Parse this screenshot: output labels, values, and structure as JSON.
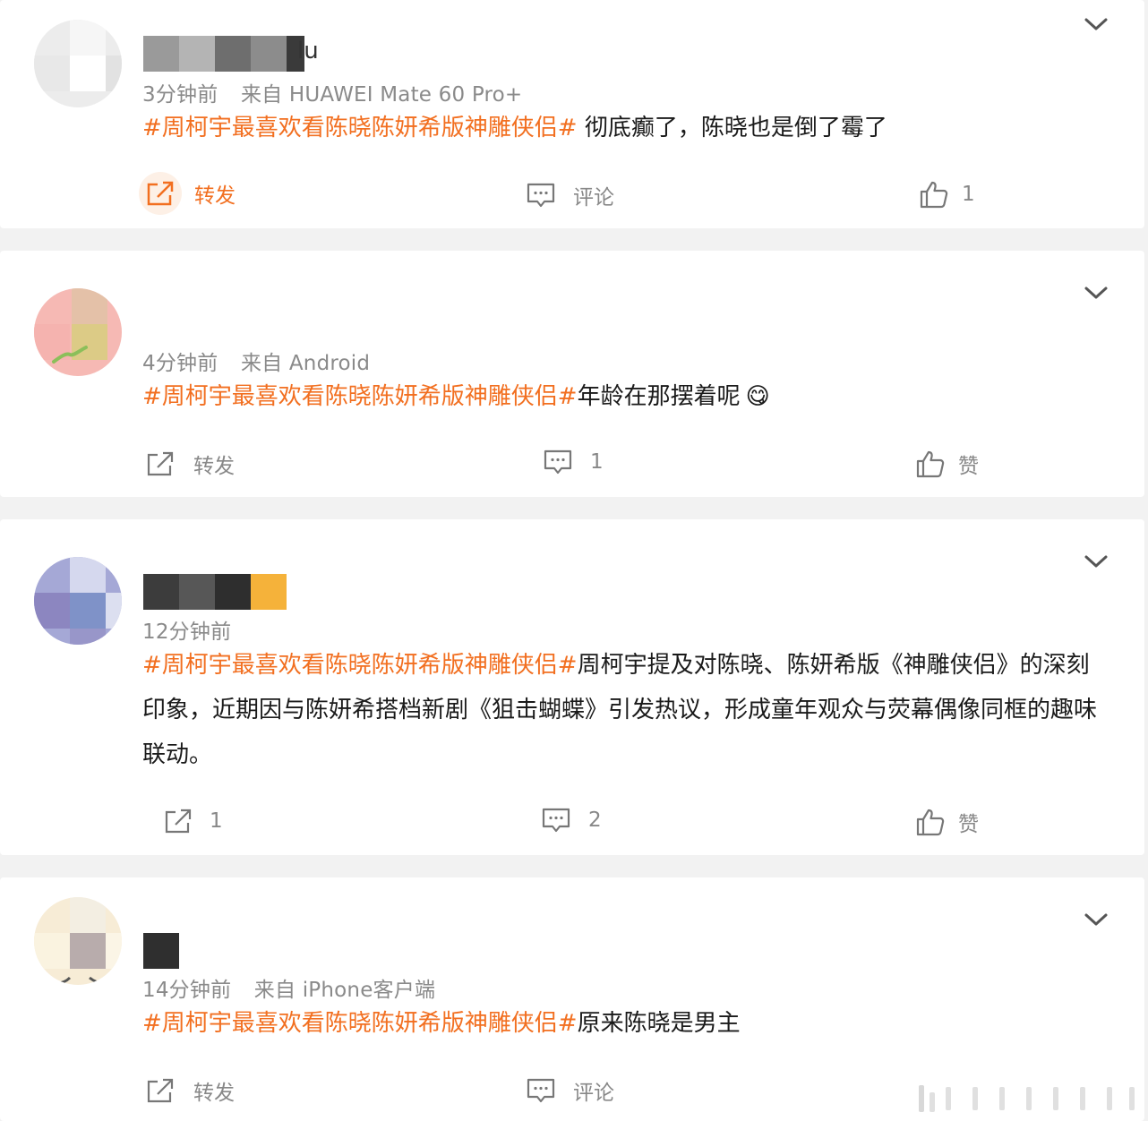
{
  "colors": {
    "topic": "#f26f20",
    "meta": "#8a8a8a",
    "text": "#1a1a1a",
    "background": "#f2f2f2",
    "card": "#ffffff"
  },
  "comments": [
    {
      "name_visible_suffix": "lu",
      "time": "3分钟前",
      "source": "来自 HUAWEI Mate 60 Pro+",
      "topic": "#周柯宇最喜欢看陈晓陈妍希版神雕侠侣#",
      "text": " 彻底癫了，陈晓也是倒了霉了",
      "repost_label": "转发",
      "comment_label": "评论",
      "like_label": "1",
      "repost_icon": "repost-icon",
      "comment_icon": "comment-icon",
      "like_icon": "thumb-up-icon"
    },
    {
      "name_visible_suffix": "",
      "time": "4分钟前",
      "source": "来自 Android",
      "topic": "#周柯宇最喜欢看陈晓陈妍希版神雕侠侣#",
      "text": "年龄在那摆着呢",
      "emoji": "😋",
      "repost_label": "转发",
      "comment_label": "1",
      "like_label": "赞"
    },
    {
      "name_visible_suffix": "",
      "time": "12分钟前",
      "source": "",
      "topic": "#周柯宇最喜欢看陈晓陈妍希版神雕侠侣#",
      "text": "周柯宇提及对陈晓、陈妍希版《神雕侠侣》的深刻印象，近期因与陈妍希搭档新剧《狙击蝴蝶》引发热议，形成童年观众与荧幕偶像同框的趣味联动。",
      "repost_label": "1",
      "comment_label": "2",
      "like_label": "赞"
    },
    {
      "name_visible_suffix": "",
      "time": "14分钟前",
      "source": "来自 iPhone客户端",
      "topic": "#周柯宇最喜欢看陈晓陈妍希版神雕侠侣#",
      "text": "原来陈晓是男主",
      "repost_label": "转发",
      "comment_label": "评论"
    }
  ]
}
